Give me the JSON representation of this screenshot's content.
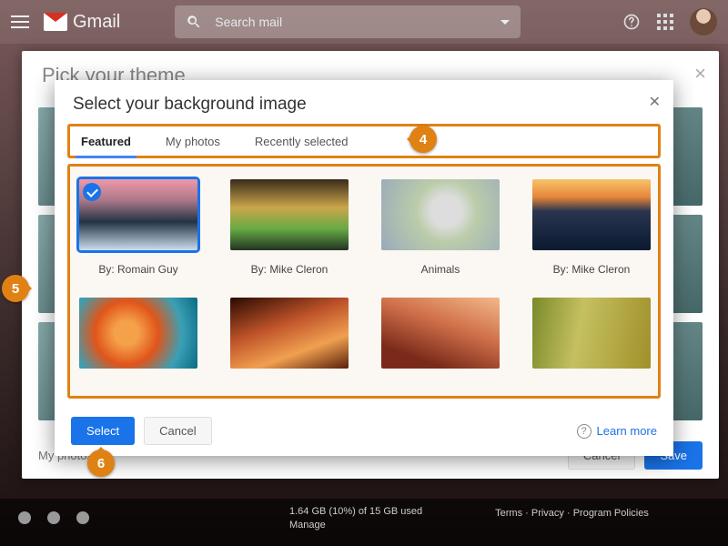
{
  "topbar": {
    "product": "Gmail",
    "search_placeholder": "Search mail"
  },
  "theme_panel": {
    "title": "Pick your theme",
    "my_photos_label": "My photos",
    "cancel": "Cancel",
    "save": "Save"
  },
  "modal": {
    "title": "Select your background image",
    "tabs": [
      "Featured",
      "My photos",
      "Recently selected"
    ],
    "active_tab": 0,
    "thumbs": [
      {
        "caption": "By: Romain Guy",
        "selected": true
      },
      {
        "caption": "By: Mike Cleron",
        "selected": false
      },
      {
        "caption": "Animals",
        "selected": false
      },
      {
        "caption": "By: Mike Cleron",
        "selected": false
      },
      {
        "caption": "",
        "selected": false
      },
      {
        "caption": "",
        "selected": false
      },
      {
        "caption": "",
        "selected": false
      },
      {
        "caption": "",
        "selected": false
      }
    ],
    "select_button": "Select",
    "cancel_button": "Cancel",
    "learn_more": "Learn more"
  },
  "callouts": {
    "b4": "4",
    "b5": "5",
    "b6": "6"
  },
  "footer": {
    "storage_line": "1.64 GB (10%) of 15 GB used",
    "manage": "Manage",
    "links": "Terms · Privacy · Program Policies"
  }
}
